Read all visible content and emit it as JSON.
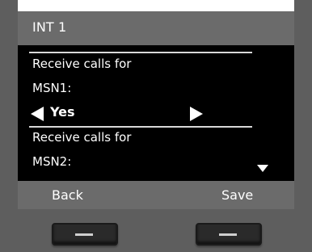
{
  "title": "INT 1",
  "menu": {
    "item1_line1": "Receive calls for",
    "item1_line2": "MSN1:",
    "item1_value": "Yes",
    "item2_line1": "Receive calls for",
    "item2_line2": "MSN2:"
  },
  "softkeys": {
    "left": "Back",
    "right": "Save"
  },
  "icons": {
    "value_prev": "triangle-left-icon",
    "value_next": "triangle-right-icon",
    "scroll": "triangle-down-icon",
    "left_key": "dash-icon",
    "right_key": "dash-icon"
  },
  "colors": {
    "screen_bg": "#000000",
    "bar_bg": "#6b6b6b",
    "housing": "#5e5e5e",
    "text": "#ffffff"
  }
}
